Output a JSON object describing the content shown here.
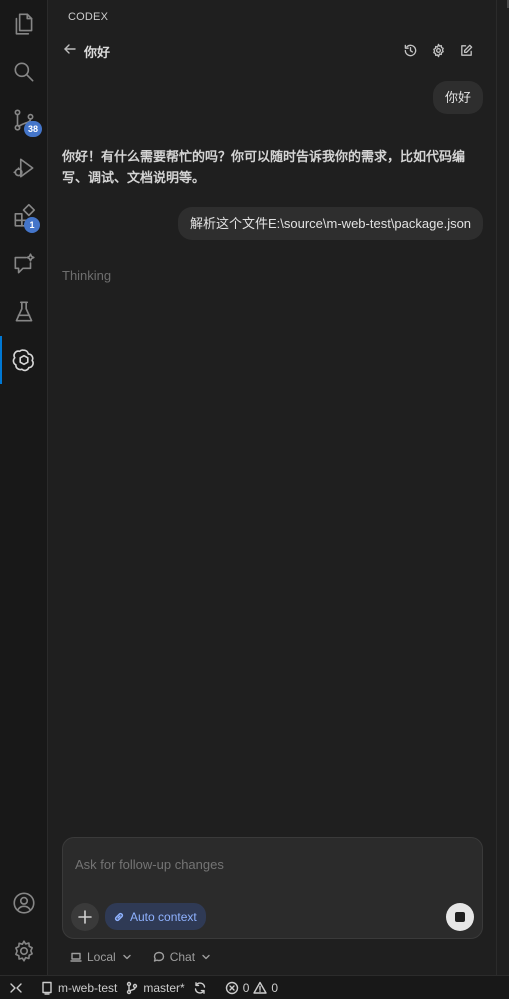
{
  "activity_bar": {
    "items": [
      {
        "name": "explorer"
      },
      {
        "name": "search"
      },
      {
        "name": "source-control",
        "badge": "38"
      },
      {
        "name": "run-debug"
      },
      {
        "name": "extensions",
        "badge": "1"
      },
      {
        "name": "chat"
      },
      {
        "name": "testing"
      },
      {
        "name": "codex"
      }
    ]
  },
  "panel": {
    "title": "CODEX",
    "chat_title": "你好"
  },
  "conversation": {
    "user_msg_1": "你好",
    "assistant_msg_1": "你好！有什么需要帮忙的吗？你可以随时告诉我你的需求，比如代码编写、调试、文档说明等。",
    "user_msg_2": "解析这个文件E:\\source\\m-web-test\\package.json",
    "thinking": "Thinking"
  },
  "composer": {
    "placeholder": "Ask for follow-up changes",
    "auto_context": "Auto context",
    "mode_local": "Local",
    "mode_chat": "Chat"
  },
  "status_bar": {
    "workspace": "m-web-test",
    "branch": "master*",
    "errors": "0",
    "warnings": "0"
  },
  "colors": {
    "accent": "#0078d4",
    "badge": "#4475c9",
    "auto_context_text": "#8fb2ff"
  }
}
